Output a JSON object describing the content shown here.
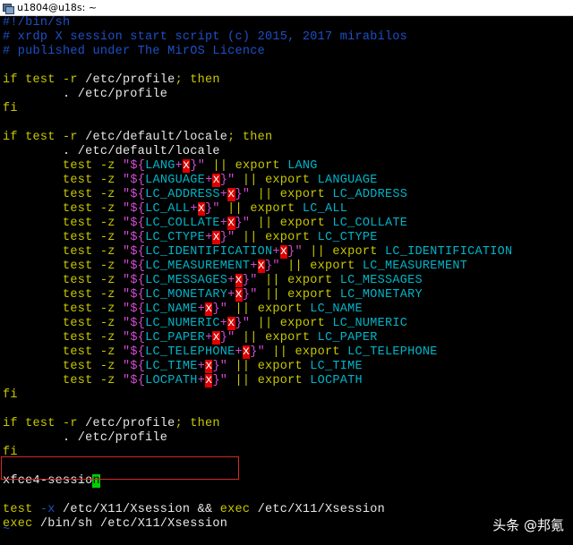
{
  "window": {
    "title": "u1804@u18s: ~",
    "icon": "terminal-icon"
  },
  "colors": {
    "background": "#000000",
    "comment": "#1e50c8",
    "keyword": "#c8c800",
    "string": "#d14bd1",
    "variable": "#00b4c8",
    "error_highlight": "#e00000",
    "cursor": "#00d000",
    "highlight_box": "#d42a2a"
  },
  "lines": {
    "l0": [
      {
        "t": "#!/bin/sh",
        "c": "cm"
      }
    ],
    "l1": [
      {
        "t": "# xrdp X session start script (c) 2015, 2017 mirabilos",
        "c": "cm"
      }
    ],
    "l2": [
      {
        "t": "# published under The MirOS Licence",
        "c": "cm"
      }
    ],
    "l3": [],
    "l4": [
      {
        "t": "if test -r ",
        "c": "kw"
      },
      {
        "t": "/etc/profile",
        "c": "wt"
      },
      {
        "t": "; then",
        "c": "kw"
      }
    ],
    "l5": [
      {
        "t": "        . /etc/profile",
        "c": "wt"
      }
    ],
    "l6": [
      {
        "t": "fi",
        "c": "kw"
      }
    ],
    "l7": [],
    "l8": [
      {
        "t": "if test -r ",
        "c": "kw"
      },
      {
        "t": "/etc/default/locale",
        "c": "wt"
      },
      {
        "t": "; then",
        "c": "kw"
      }
    ],
    "l9": [
      {
        "t": "        . /etc/default/locale",
        "c": "wt"
      }
    ],
    "l10": [
      {
        "t": "        test -z ",
        "c": "kw"
      },
      {
        "t": "\"${",
        "c": "str"
      },
      {
        "t": "LANG",
        "c": "cy"
      },
      {
        "t": "+",
        "c": "str"
      },
      {
        "t": "x",
        "c": "err"
      },
      {
        "t": "}\"",
        "c": "str"
      },
      {
        "t": " || ",
        "c": "kw"
      },
      {
        "t": "export ",
        "c": "kw"
      },
      {
        "t": "LANG",
        "c": "cy"
      }
    ],
    "l11": [
      {
        "t": "        test -z ",
        "c": "kw"
      },
      {
        "t": "\"${",
        "c": "str"
      },
      {
        "t": "LANGUAGE",
        "c": "cy"
      },
      {
        "t": "+",
        "c": "str"
      },
      {
        "t": "x",
        "c": "err"
      },
      {
        "t": "}\"",
        "c": "str"
      },
      {
        "t": " || ",
        "c": "kw"
      },
      {
        "t": "export ",
        "c": "kw"
      },
      {
        "t": "LANGUAGE",
        "c": "cy"
      }
    ],
    "l12": [
      {
        "t": "        test -z ",
        "c": "kw"
      },
      {
        "t": "\"${",
        "c": "str"
      },
      {
        "t": "LC_ADDRESS",
        "c": "cy"
      },
      {
        "t": "+",
        "c": "str"
      },
      {
        "t": "x",
        "c": "err"
      },
      {
        "t": "}\"",
        "c": "str"
      },
      {
        "t": " || ",
        "c": "kw"
      },
      {
        "t": "export ",
        "c": "kw"
      },
      {
        "t": "LC_ADDRESS",
        "c": "cy"
      }
    ],
    "l13": [
      {
        "t": "        test -z ",
        "c": "kw"
      },
      {
        "t": "\"${",
        "c": "str"
      },
      {
        "t": "LC_ALL",
        "c": "cy"
      },
      {
        "t": "+",
        "c": "str"
      },
      {
        "t": "x",
        "c": "err"
      },
      {
        "t": "}\"",
        "c": "str"
      },
      {
        "t": " || ",
        "c": "kw"
      },
      {
        "t": "export ",
        "c": "kw"
      },
      {
        "t": "LC_ALL",
        "c": "cy"
      }
    ],
    "l14": [
      {
        "t": "        test -z ",
        "c": "kw"
      },
      {
        "t": "\"${",
        "c": "str"
      },
      {
        "t": "LC_COLLATE",
        "c": "cy"
      },
      {
        "t": "+",
        "c": "str"
      },
      {
        "t": "x",
        "c": "err"
      },
      {
        "t": "}\"",
        "c": "str"
      },
      {
        "t": " || ",
        "c": "kw"
      },
      {
        "t": "export ",
        "c": "kw"
      },
      {
        "t": "LC_COLLATE",
        "c": "cy"
      }
    ],
    "l15": [
      {
        "t": "        test -z ",
        "c": "kw"
      },
      {
        "t": "\"${",
        "c": "str"
      },
      {
        "t": "LC_CTYPE",
        "c": "cy"
      },
      {
        "t": "+",
        "c": "str"
      },
      {
        "t": "x",
        "c": "err"
      },
      {
        "t": "}\"",
        "c": "str"
      },
      {
        "t": " || ",
        "c": "kw"
      },
      {
        "t": "export ",
        "c": "kw"
      },
      {
        "t": "LC_CTYPE",
        "c": "cy"
      }
    ],
    "l16": [
      {
        "t": "        test -z ",
        "c": "kw"
      },
      {
        "t": "\"${",
        "c": "str"
      },
      {
        "t": "LC_IDENTIFICATION",
        "c": "cy"
      },
      {
        "t": "+",
        "c": "str"
      },
      {
        "t": "x",
        "c": "err"
      },
      {
        "t": "}\"",
        "c": "str"
      },
      {
        "t": " || ",
        "c": "kw"
      },
      {
        "t": "export ",
        "c": "kw"
      },
      {
        "t": "LC_IDENTIFICATION",
        "c": "cy"
      }
    ],
    "l17": [
      {
        "t": "        test -z ",
        "c": "kw"
      },
      {
        "t": "\"${",
        "c": "str"
      },
      {
        "t": "LC_MEASUREMENT",
        "c": "cy"
      },
      {
        "t": "+",
        "c": "str"
      },
      {
        "t": "x",
        "c": "err"
      },
      {
        "t": "}\"",
        "c": "str"
      },
      {
        "t": " || ",
        "c": "kw"
      },
      {
        "t": "export ",
        "c": "kw"
      },
      {
        "t": "LC_MEASUREMENT",
        "c": "cy"
      }
    ],
    "l18": [
      {
        "t": "        test -z ",
        "c": "kw"
      },
      {
        "t": "\"${",
        "c": "str"
      },
      {
        "t": "LC_MESSAGES",
        "c": "cy"
      },
      {
        "t": "+",
        "c": "str"
      },
      {
        "t": "x",
        "c": "err"
      },
      {
        "t": "}\"",
        "c": "str"
      },
      {
        "t": " || ",
        "c": "kw"
      },
      {
        "t": "export ",
        "c": "kw"
      },
      {
        "t": "LC_MESSAGES",
        "c": "cy"
      }
    ],
    "l19": [
      {
        "t": "        test -z ",
        "c": "kw"
      },
      {
        "t": "\"${",
        "c": "str"
      },
      {
        "t": "LC_MONETARY",
        "c": "cy"
      },
      {
        "t": "+",
        "c": "str"
      },
      {
        "t": "x",
        "c": "err"
      },
      {
        "t": "}\"",
        "c": "str"
      },
      {
        "t": " || ",
        "c": "kw"
      },
      {
        "t": "export ",
        "c": "kw"
      },
      {
        "t": "LC_MONETARY",
        "c": "cy"
      }
    ],
    "l20": [
      {
        "t": "        test -z ",
        "c": "kw"
      },
      {
        "t": "\"${",
        "c": "str"
      },
      {
        "t": "LC_NAME",
        "c": "cy"
      },
      {
        "t": "+",
        "c": "str"
      },
      {
        "t": "x",
        "c": "err"
      },
      {
        "t": "}\"",
        "c": "str"
      },
      {
        "t": " || ",
        "c": "kw"
      },
      {
        "t": "export ",
        "c": "kw"
      },
      {
        "t": "LC_NAME",
        "c": "cy"
      }
    ],
    "l21": [
      {
        "t": "        test -z ",
        "c": "kw"
      },
      {
        "t": "\"${",
        "c": "str"
      },
      {
        "t": "LC_NUMERIC",
        "c": "cy"
      },
      {
        "t": "+",
        "c": "str"
      },
      {
        "t": "x",
        "c": "err"
      },
      {
        "t": "}\"",
        "c": "str"
      },
      {
        "t": " || ",
        "c": "kw"
      },
      {
        "t": "export ",
        "c": "kw"
      },
      {
        "t": "LC_NUMERIC",
        "c": "cy"
      }
    ],
    "l22": [
      {
        "t": "        test -z ",
        "c": "kw"
      },
      {
        "t": "\"${",
        "c": "str"
      },
      {
        "t": "LC_PAPER",
        "c": "cy"
      },
      {
        "t": "+",
        "c": "str"
      },
      {
        "t": "x",
        "c": "err"
      },
      {
        "t": "}\"",
        "c": "str"
      },
      {
        "t": " || ",
        "c": "kw"
      },
      {
        "t": "export ",
        "c": "kw"
      },
      {
        "t": "LC_PAPER",
        "c": "cy"
      }
    ],
    "l23": [
      {
        "t": "        test -z ",
        "c": "kw"
      },
      {
        "t": "\"${",
        "c": "str"
      },
      {
        "t": "LC_TELEPHONE",
        "c": "cy"
      },
      {
        "t": "+",
        "c": "str"
      },
      {
        "t": "x",
        "c": "err"
      },
      {
        "t": "}\"",
        "c": "str"
      },
      {
        "t": " || ",
        "c": "kw"
      },
      {
        "t": "export ",
        "c": "kw"
      },
      {
        "t": "LC_TELEPHONE",
        "c": "cy"
      }
    ],
    "l24": [
      {
        "t": "        test -z ",
        "c": "kw"
      },
      {
        "t": "\"${",
        "c": "str"
      },
      {
        "t": "LC_TIME",
        "c": "cy"
      },
      {
        "t": "+",
        "c": "str"
      },
      {
        "t": "x",
        "c": "err"
      },
      {
        "t": "}\"",
        "c": "str"
      },
      {
        "t": " || ",
        "c": "kw"
      },
      {
        "t": "export ",
        "c": "kw"
      },
      {
        "t": "LC_TIME",
        "c": "cy"
      }
    ],
    "l25": [
      {
        "t": "        test -z ",
        "c": "kw"
      },
      {
        "t": "\"${",
        "c": "str"
      },
      {
        "t": "LOCPATH",
        "c": "cy"
      },
      {
        "t": "+",
        "c": "str"
      },
      {
        "t": "x",
        "c": "err"
      },
      {
        "t": "}\"",
        "c": "str"
      },
      {
        "t": " || ",
        "c": "kw"
      },
      {
        "t": "export ",
        "c": "kw"
      },
      {
        "t": "LOCPATH",
        "c": "cy"
      }
    ],
    "l26": [
      {
        "t": "fi",
        "c": "kw"
      }
    ],
    "l27": [],
    "l28": [
      {
        "t": "if test -r ",
        "c": "kw"
      },
      {
        "t": "/etc/profile",
        "c": "wt"
      },
      {
        "t": "; then",
        "c": "kw"
      }
    ],
    "l29": [
      {
        "t": "        . /etc/profile",
        "c": "wt"
      }
    ],
    "l30": [
      {
        "t": "fi",
        "c": "kw"
      }
    ],
    "l31": [],
    "l32": [
      {
        "t": "xfce4-sessio",
        "c": "wt"
      },
      {
        "t": "n",
        "c": "cursor"
      }
    ],
    "l33": [],
    "l34": [
      {
        "t": "test ",
        "c": "kw"
      },
      {
        "t": "-x",
        "c": "cm"
      },
      {
        "t": " /etc/X11/Xsession && ",
        "c": "wt"
      },
      {
        "t": "exec",
        "c": "kw"
      },
      {
        "t": " /etc/X11/Xsession",
        "c": "wt"
      }
    ],
    "l35": [
      {
        "t": "exec",
        "c": "kw"
      },
      {
        "t": " /bin/sh /etc/X11/Xsession",
        "c": "wt"
      }
    ]
  },
  "tilde": "~",
  "watermark": "头条 @邦氪"
}
